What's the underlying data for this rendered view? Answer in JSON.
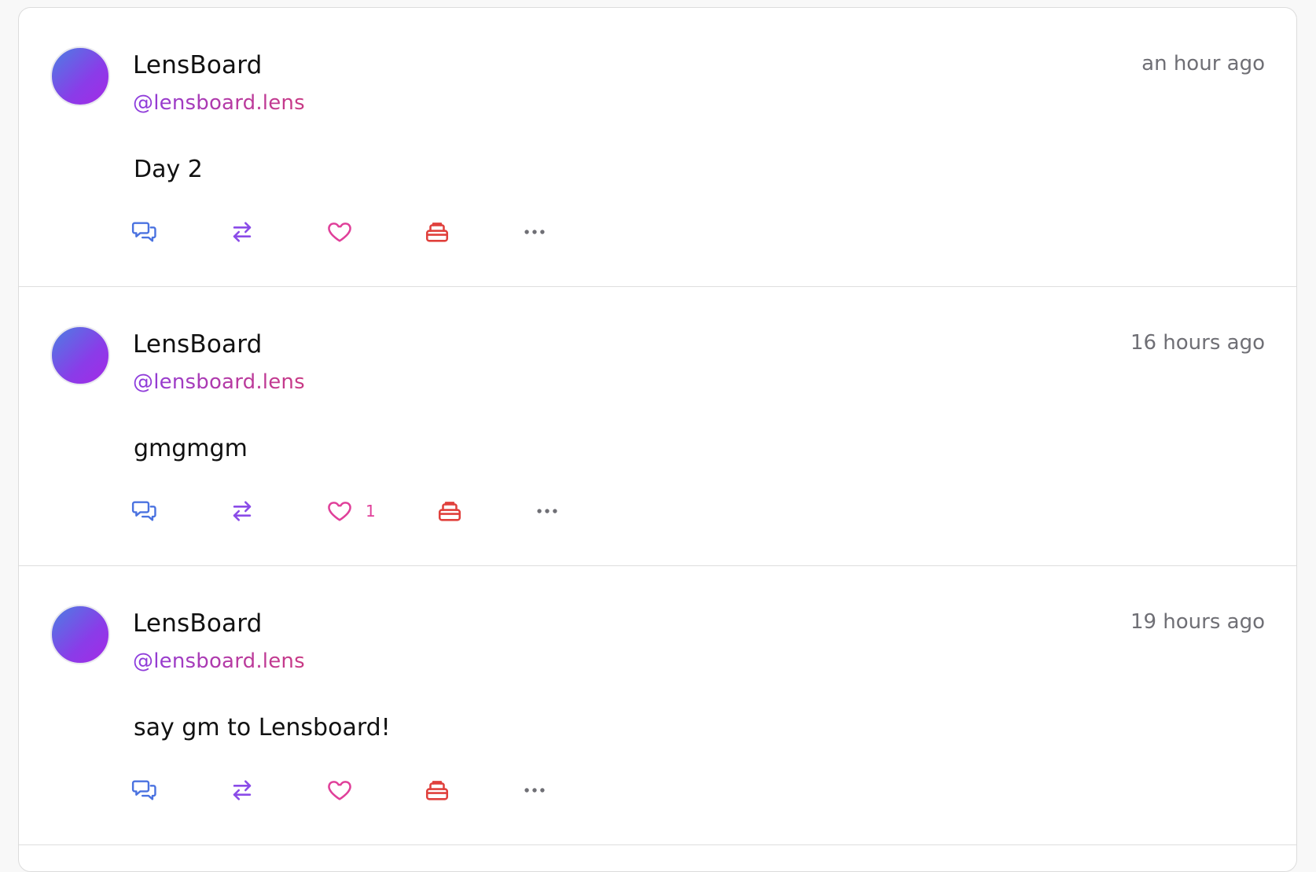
{
  "colors": {
    "comment": "#4a72e0",
    "mirror": "#8a4be8",
    "like": "#e0409a",
    "collect": "#e0403c",
    "more": "#6f6f75"
  },
  "icons": {
    "comment": "comment-icon",
    "mirror": "mirror-icon",
    "like": "heart-icon",
    "collect": "collect-icon",
    "more": "more-dots-icon"
  },
  "posts": [
    {
      "author_name": "LensBoard",
      "handle": "@lensboard.lens",
      "time": "an hour ago",
      "content": "Day 2",
      "like_count": ""
    },
    {
      "author_name": "LensBoard",
      "handle": "@lensboard.lens",
      "time": "16 hours ago",
      "content": "gmgmgm",
      "like_count": "1"
    },
    {
      "author_name": "LensBoard",
      "handle": "@lensboard.lens",
      "time": "19 hours ago",
      "content": "say gm to Lensboard!",
      "like_count": ""
    }
  ]
}
